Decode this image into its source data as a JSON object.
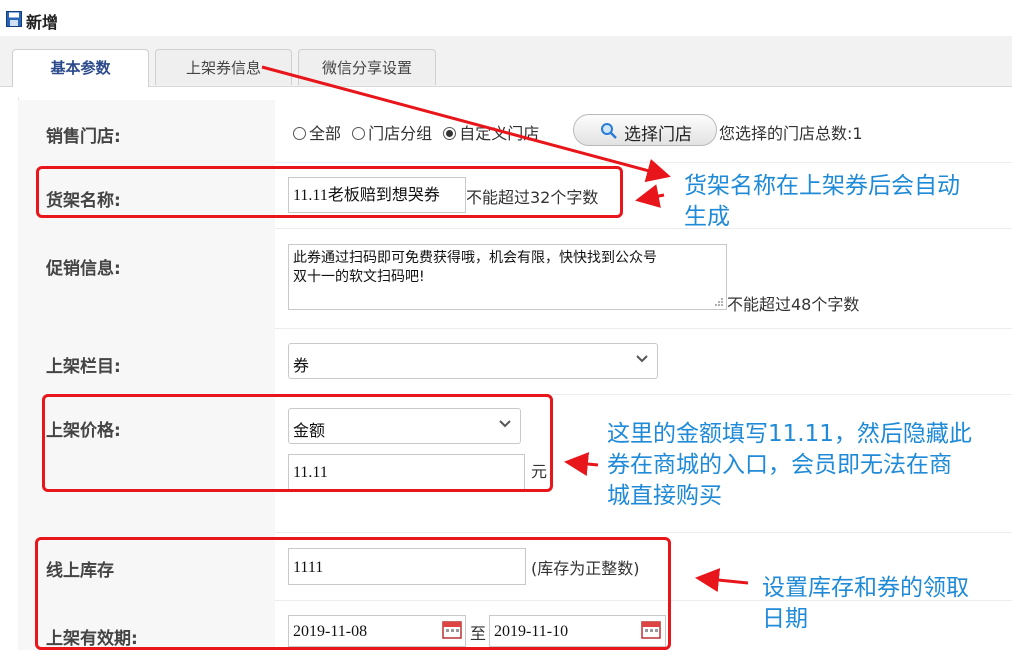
{
  "window": {
    "title": "新增"
  },
  "tabs": [
    {
      "label": "基本参数",
      "active": true
    },
    {
      "label": "上架券信息",
      "active": false
    },
    {
      "label": "微信分享设置",
      "active": false
    }
  ],
  "form": {
    "store": {
      "label": "销售门店:",
      "options": [
        "全部",
        "门店分组",
        "自定义门店"
      ],
      "selected": "自定义门店",
      "button_label": "选择门店",
      "total_text": "您选择的门店总数:1"
    },
    "shelf_name": {
      "label": "货架名称:",
      "value": "11.11老板赔到想哭券",
      "hint": "不能超过32个字数"
    },
    "promo": {
      "label": "促销信息:",
      "value_line1": "此券通过扫码即可免费获得哦，机会有限，快快找到公众号",
      "value_line2": "双十一的软文扫码吧!",
      "hint": "不能超过48个字数"
    },
    "column": {
      "label": "上架栏目:",
      "selected": "券"
    },
    "price": {
      "label": "上架价格:",
      "type_selected": "金额",
      "value": "11.11",
      "unit": "元"
    },
    "stock": {
      "label": "线上库存",
      "value": "1111",
      "hint": "(库存为正整数)"
    },
    "validity": {
      "label": "上架有效期:",
      "start": "2019-11-08",
      "separator": "至",
      "end": "2019-11-10"
    }
  },
  "annotations": {
    "note1_line1": "货架名称在上架券后会自动",
    "note1_line2": "生成",
    "note2_line1": "这里的金额填写11.11，然后隐藏此",
    "note2_line2": "券在商城的入口，会员即无法在商",
    "note2_line3": "城直接购买",
    "note3_line1": "设置库存和券的领取",
    "note3_line2": "日期"
  },
  "colors": {
    "annotation_red": "#e8161b",
    "annotation_blue": "#1f8ad8",
    "tab_active_text": "#2b4a8a"
  }
}
